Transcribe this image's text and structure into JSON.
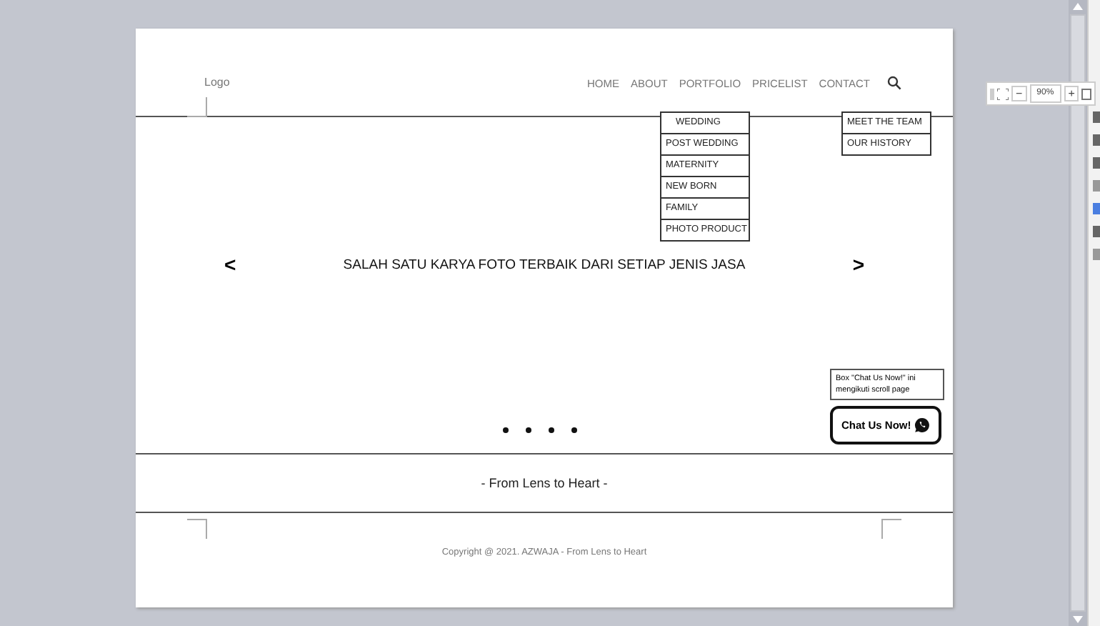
{
  "logo": "Logo",
  "nav": [
    {
      "label": "HOME"
    },
    {
      "label": "ABOUT"
    },
    {
      "label": "PORTFOLIO"
    },
    {
      "label": "PRICELIST"
    },
    {
      "label": "CONTACT"
    }
  ],
  "portfolio_menu": [
    "WEDDING",
    "POST WEDDING",
    "MATERNITY",
    "NEW BORN",
    "FAMILY",
    "PHOTO PRODUCT"
  ],
  "about_menu": [
    "MEET THE TEAM",
    "OUR HISTORY"
  ],
  "hero": {
    "prev": "<",
    "headline": "SALAH SATU KARYA FOTO TERBAIK DARI SETIAP JENIS JASA",
    "next": ">"
  },
  "note": "Box \"Chat Us Now!\" ini mengikuti scroll page",
  "chat_button": "Chat Us Now!",
  "tagline": "- From Lens to Heart -",
  "copyright": "Copyright @ 2021. AZWAJA - From Lens to Heart",
  "zoom": {
    "minus": "−",
    "value": "90%",
    "plus": "+"
  }
}
